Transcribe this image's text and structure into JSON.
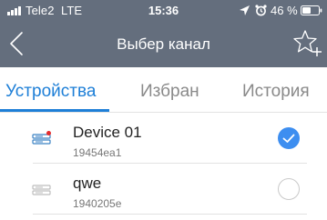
{
  "status_bar": {
    "carrier": "Tele2",
    "network": "LTE",
    "time": "15:36",
    "battery": "46 %",
    "icons": [
      "signal-icon",
      "location-arrow-icon",
      "alarm-clock-icon",
      "battery-icon"
    ]
  },
  "nav": {
    "title": "Выбер канал",
    "back_icon": "chevron-left-icon",
    "action_icon": "star-plus-icon"
  },
  "tabs": [
    {
      "label": "Устройства",
      "active": true
    },
    {
      "label": "Избран",
      "active": false
    },
    {
      "label": "История",
      "active": false
    }
  ],
  "devices": [
    {
      "name": "Device 01",
      "id": "19454ea1",
      "selected": true,
      "status_dot": true
    },
    {
      "name": "qwe",
      "id": "1940205e",
      "selected": false,
      "status_dot": false
    }
  ],
  "colors": {
    "header_bg": "#646e7d",
    "accent": "#1e7fd7",
    "check_on": "#3d8ef0",
    "status_dot": "#e52b2b"
  }
}
